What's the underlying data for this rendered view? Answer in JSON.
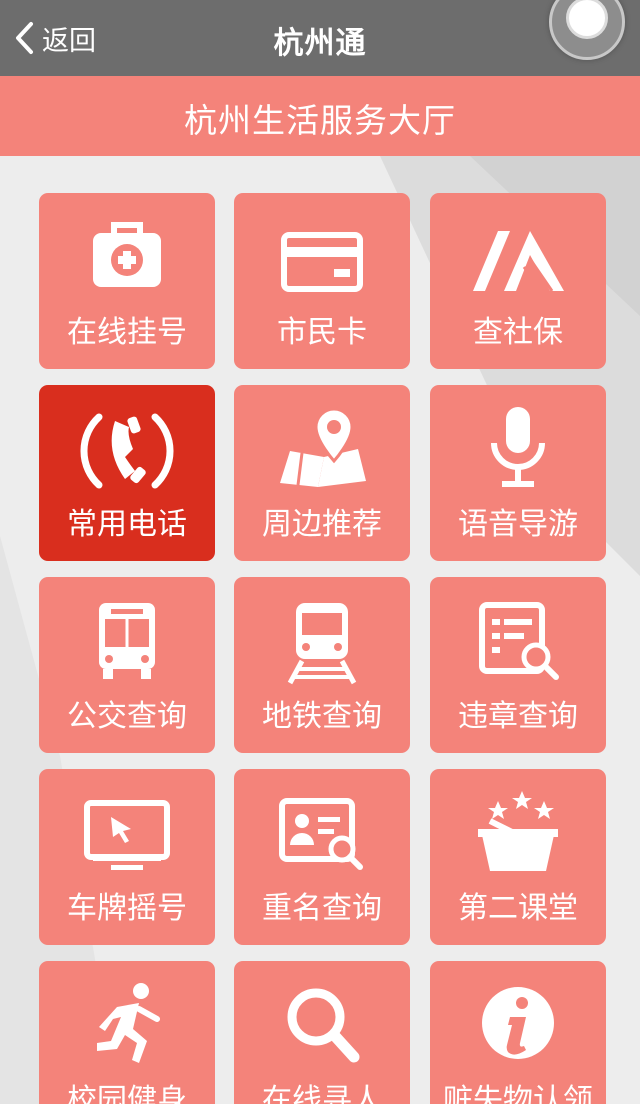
{
  "navbar": {
    "back_label": "返回",
    "title": "杭州通"
  },
  "banner": {
    "title": "杭州生活服务大厅"
  },
  "tiles": [
    {
      "label": "在线挂号",
      "icon": "medical-kit-icon"
    },
    {
      "label": "市民卡",
      "icon": "card-icon"
    },
    {
      "label": "查社保",
      "icon": "social-security-logo-icon"
    },
    {
      "label": "常用电话",
      "icon": "phone-icon",
      "selected": true
    },
    {
      "label": "周边推荐",
      "icon": "map-pin-icon"
    },
    {
      "label": "语音导游",
      "icon": "microphone-icon"
    },
    {
      "label": "公交查询",
      "icon": "bus-icon"
    },
    {
      "label": "地铁查询",
      "icon": "metro-icon"
    },
    {
      "label": "违章查询",
      "icon": "document-search-icon"
    },
    {
      "label": "车牌摇号",
      "icon": "monitor-icon"
    },
    {
      "label": "重名查询",
      "icon": "id-card-search-icon"
    },
    {
      "label": "第二课堂",
      "icon": "basket-stars-icon"
    },
    {
      "label": "校园健身",
      "icon": "runner-icon"
    },
    {
      "label": "在线寻人",
      "icon": "magnifier-icon"
    },
    {
      "label": "赃失物认领",
      "icon": "info-icon"
    }
  ],
  "colors": {
    "navbar": "#6d6d6d",
    "banner": "#f4837a",
    "tile": "#f4837a",
    "tile_selected": "#d92e1e"
  }
}
